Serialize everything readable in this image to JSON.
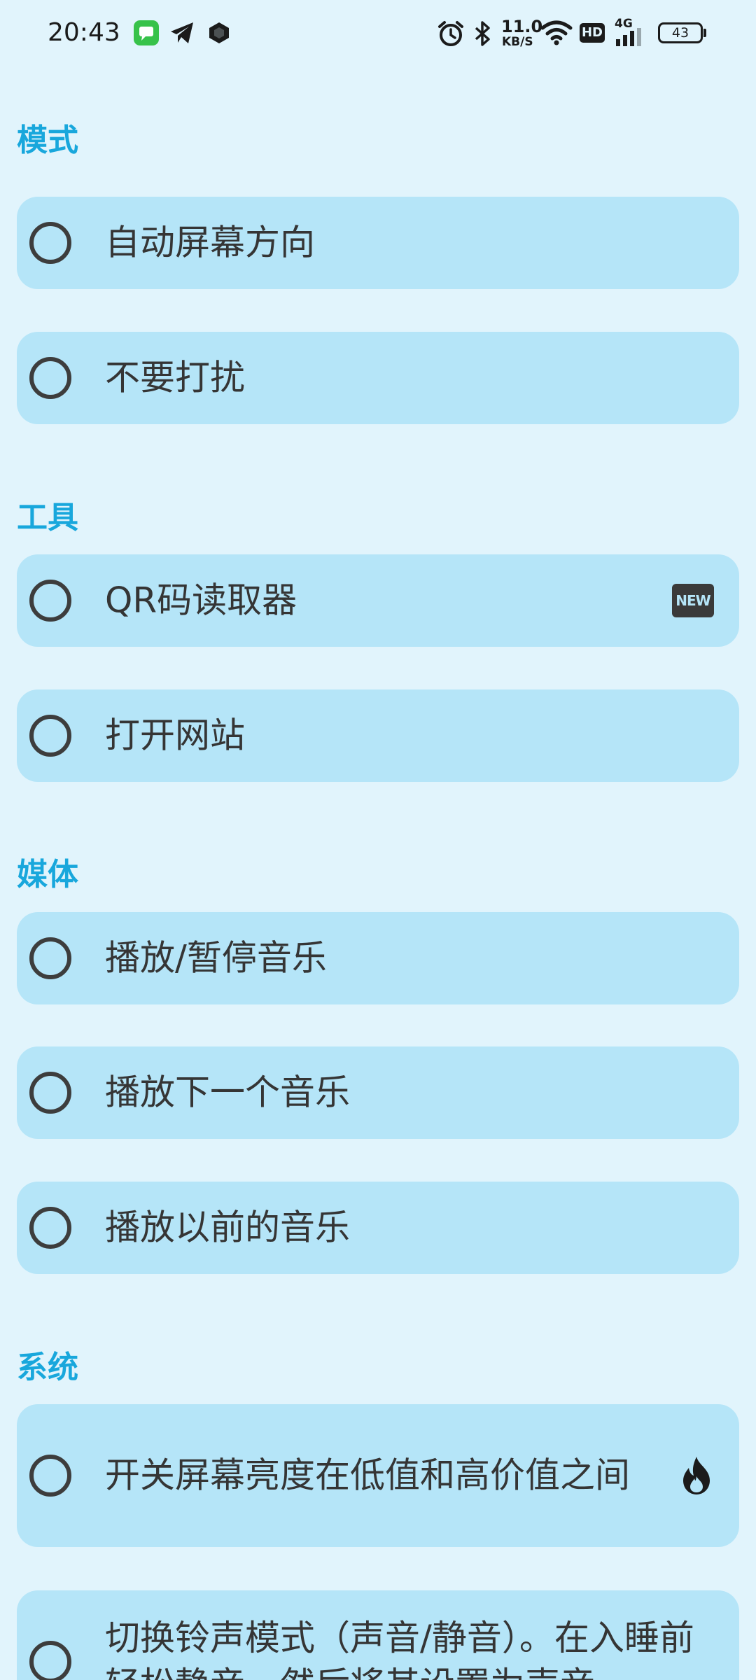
{
  "status_bar": {
    "time": "20:43",
    "net_speed_value": "11.0",
    "net_speed_unit": "KB/S",
    "hd_label": "HD",
    "network_type": "4G",
    "battery": "43",
    "icons": [
      "message-app-icon",
      "telegram-icon",
      "hex-app-icon",
      "alarm-icon",
      "bluetooth-icon",
      "wifi-icon",
      "signal-icon",
      "battery-icon"
    ]
  },
  "sections": [
    {
      "title": "模式",
      "items": [
        {
          "label": "自动屏幕方向"
        },
        {
          "label": "不要打扰"
        }
      ]
    },
    {
      "title": "工具",
      "items": [
        {
          "label": "QR码读取器",
          "badge": "NEW"
        },
        {
          "label": "打开网站"
        }
      ]
    },
    {
      "title": "媒体",
      "items": [
        {
          "label": "播放/暂停音乐"
        },
        {
          "label": "播放下一个音乐"
        },
        {
          "label": "播放以前的音乐"
        }
      ]
    },
    {
      "title": "系统",
      "items": [
        {
          "label": "开关屏幕亮度在低值和高价值之间",
          "badge_icon": "fire-icon"
        },
        {
          "label": "切换铃声模式（声音/静音）。在入睡前轻松静音，然后将其设置为声音"
        }
      ]
    }
  ],
  "colors": {
    "background": "#e1f4fc",
    "card": "#b5e5f8",
    "section_title": "#18a7dc",
    "text": "#353535"
  }
}
